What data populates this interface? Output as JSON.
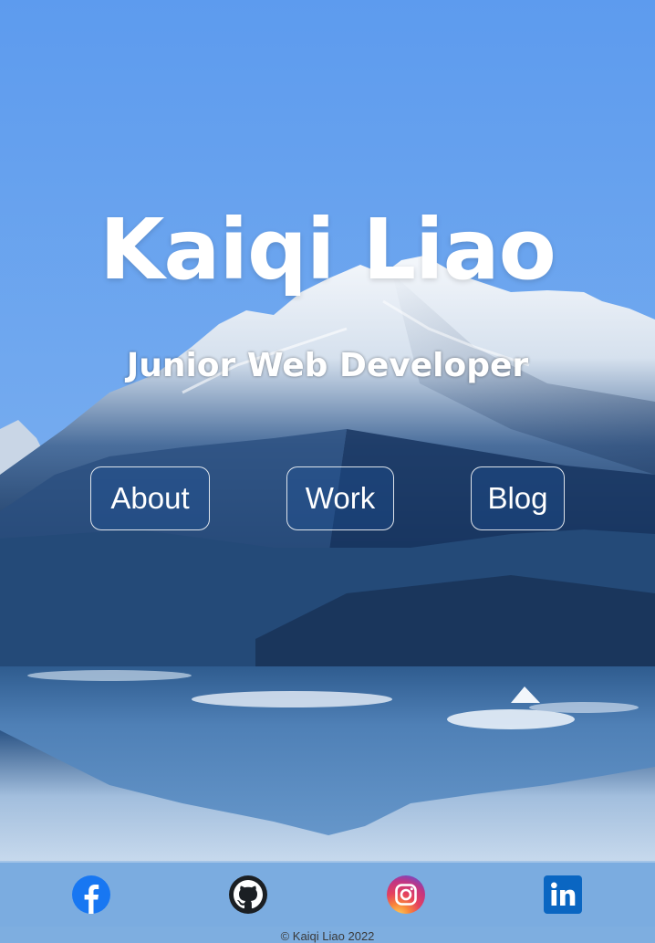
{
  "hero": {
    "name": "Kaiqi Liao",
    "role": "Junior Web Developer"
  },
  "nav": [
    {
      "label": "About"
    },
    {
      "label": "Work"
    },
    {
      "label": "Blog"
    }
  ],
  "social": [
    {
      "icon": "facebook-icon"
    },
    {
      "icon": "github-icon"
    },
    {
      "icon": "instagram-icon"
    },
    {
      "icon": "linkedin-icon"
    }
  ],
  "footer": {
    "copyright": "© Kaiqi Liao 2022"
  },
  "colors": {
    "sky_top": "#5d9bee",
    "sky_bottom": "#7ab0ec",
    "lake": "#3b6fa8",
    "text": "#ffffff",
    "facebook": "#1877f2",
    "linkedin": "#0a66c2"
  }
}
